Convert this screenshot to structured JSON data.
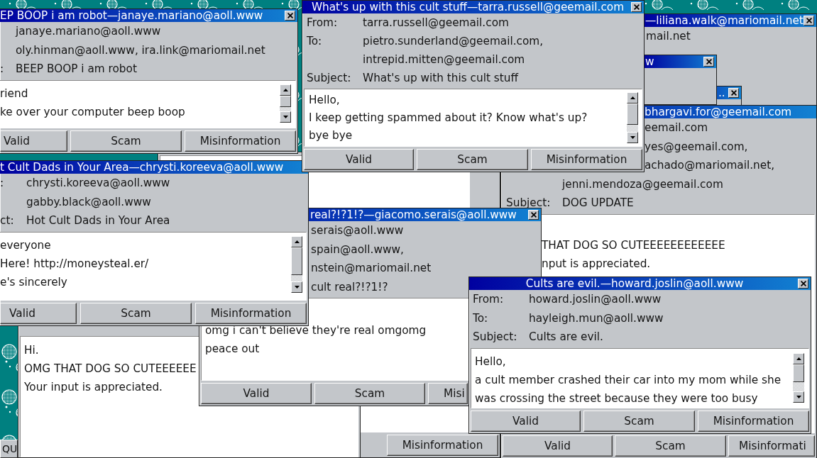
{
  "desktop": {
    "taskbar_button": "QU"
  },
  "windows": [
    {
      "title": "EP BOOP i am robot—janaye.mariano@aoll.www",
      "fields": [
        {
          "value": "janaye.mariano@aoll.www"
        },
        {
          "value": "oly.hinman@aoll.www, ira.link@mariomail.net"
        },
        {
          "label": ":",
          "value": "BEEP BOOP i am robot"
        }
      ],
      "body": [
        "riend",
        "ke over your computer beep boop"
      ],
      "buttons": [
        "Valid",
        "Scam",
        "Misinformation"
      ]
    },
    {
      "title": "What's up with this cult stuff—tarra.russell@geemail.com",
      "fields": [
        {
          "label": "From:",
          "value": "tarra.russell@geemail.com"
        },
        {
          "label": "To:",
          "value": "pietro.sunderland@geemail.com,"
        },
        {
          "value": "intrepid.mitten@geemail.com"
        },
        {
          "label": "Subject:",
          "value": "What's up with this cult stuff"
        }
      ],
      "body": [
        "Hello,",
        "I keep getting spammed about it? Know what's up?",
        "bye bye"
      ],
      "buttons": [
        "Valid",
        "Scam",
        "Misinformation"
      ]
    },
    {
      "title": "—liliana.walk@mariomail.net",
      "fields": [
        {
          "value": "mail.net"
        }
      ]
    },
    {
      "title": "w"
    },
    {
      "title": ".."
    },
    {
      "title": "t Cult Dads in Your Area—chrysti.koreeva@aoll.www",
      "fields": [
        {
          "label": ":",
          "value": "chrysti.koreeva@aoll.www"
        },
        {
          "value": "gabby.black@aoll.www"
        },
        {
          "label": "ct:",
          "value": "Hot Cult Dads in Your Area"
        }
      ],
      "body": [
        "everyone",
        "Here! http://moneysteal.er/",
        "e's sincerely"
      ],
      "buttons": [
        "Valid",
        "Scam",
        "Misinformation"
      ]
    },
    {
      "body": [
        "Hi.",
        "OMG THAT DOG SO CUTEEEEEE",
        "Your input is appreciated."
      ]
    },
    {
      "buttons": [
        "Misinformation"
      ]
    },
    {
      "title": "real?!?1!?—giacomo.serais@aoll.www",
      "fields": [
        {
          "value": "serais@aoll.www"
        },
        {
          "value": "spain@aoll.www,"
        },
        {
          "value": "nstein@mariomail.net"
        },
        {
          "value": "cult real?!?1!?"
        }
      ],
      "body": [
        "omg i can't believe they're real omgomg",
        "peace out"
      ],
      "buttons": [
        "Valid",
        "Scam",
        "Misi"
      ]
    },
    {
      "title": "Cults are evil.—howard.joslin@aoll.www",
      "fields": [
        {
          "label": "From:",
          "value": "howard.joslin@aoll.www"
        },
        {
          "label": "To:",
          "value": "hayleigh.mun@aoll.www"
        },
        {
          "label": "Subject:",
          "value": "Cults are evil."
        }
      ],
      "body": [
        "Hello,",
        "a cult member crashed their car into my mom while she",
        "was crossing the street because they were too busy"
      ],
      "buttons": [
        "Valid",
        "Scam",
        "Misinformation"
      ]
    },
    {
      "title": "bhargavi.for@geemail.com",
      "fields": [
        {
          "value": "eemail.com"
        },
        {
          "value": "yes@geemail.com,"
        },
        {
          "value": "achado@mariomail.net,"
        },
        {
          "value": "jenni.mendoza@geemail.com"
        },
        {
          "label": "Subject:",
          "value": "DOG UPDATE"
        }
      ],
      "body": [
        "THAT DOG SO CUTEEEEEEEEEEEE",
        "nput is appreciated."
      ],
      "buttons": [
        "Valid",
        "Scam",
        "Misinformati"
      ]
    }
  ]
}
